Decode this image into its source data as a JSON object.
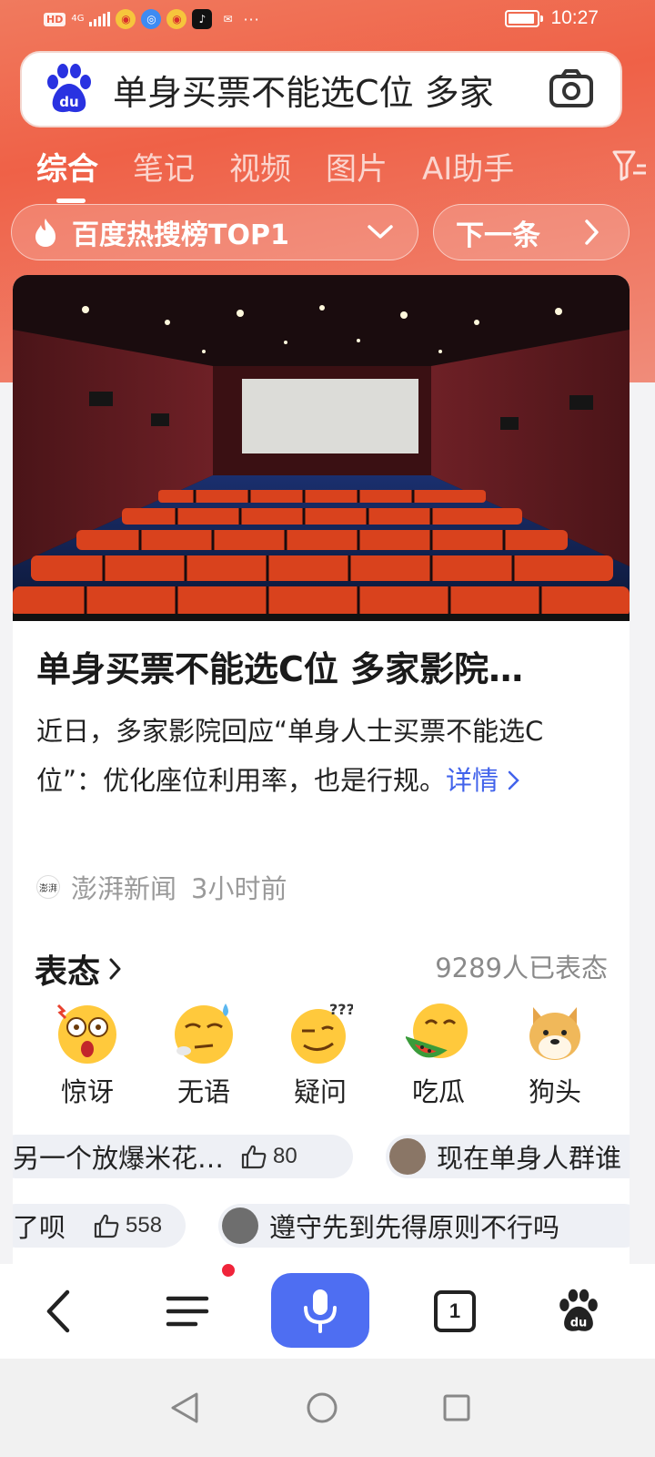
{
  "status_bar": {
    "hd": "HD",
    "network": "4G",
    "time": "10:27",
    "more": "···"
  },
  "search": {
    "query": "单身买票不能选C位 多家"
  },
  "tabs": [
    {
      "label": "综合",
      "active": true
    },
    {
      "label": "笔记",
      "active": false
    },
    {
      "label": "视频",
      "active": false
    },
    {
      "label": "图片",
      "active": false
    },
    {
      "label": "AI助手",
      "active": false
    }
  ],
  "hotbar": {
    "label": "百度热搜榜TOP1",
    "next_label": "下一条"
  },
  "news": {
    "title": "单身买票不能选C位 多家影院…",
    "summary": "近日，多家影院回应“单身人士买票不能选C位”：优化座位利用率，也是行规。",
    "more": "详情",
    "source_logo": "澎湃",
    "source": "澎湃新闻",
    "time": "3小时前"
  },
  "reactions": {
    "title": "表态",
    "count": "9289人已表态",
    "items": [
      {
        "label": "惊讶",
        "icon": "surprised-emoji-icon"
      },
      {
        "label": "无语",
        "icon": "speechless-emoji-icon"
      },
      {
        "label": "疑问",
        "icon": "question-emoji-icon"
      },
      {
        "label": "吃瓜",
        "icon": "eating-melon-emoji-icon"
      },
      {
        "label": "狗头",
        "icon": "doge-emoji-icon"
      }
    ]
  },
  "comments": {
    "row1": [
      {
        "text": "另一个放爆米花…",
        "likes": "80"
      },
      {
        "text": "现在单身人群谁"
      }
    ],
    "row2": [
      {
        "text": "了呗",
        "likes": "558"
      },
      {
        "text": "遵守先到先得原则不行吗"
      }
    ]
  },
  "bottom_nav": {
    "tab_count": "1"
  },
  "colors": {
    "accent": "#ef6147",
    "link": "#4263eb",
    "mic": "#4e6ef2"
  }
}
